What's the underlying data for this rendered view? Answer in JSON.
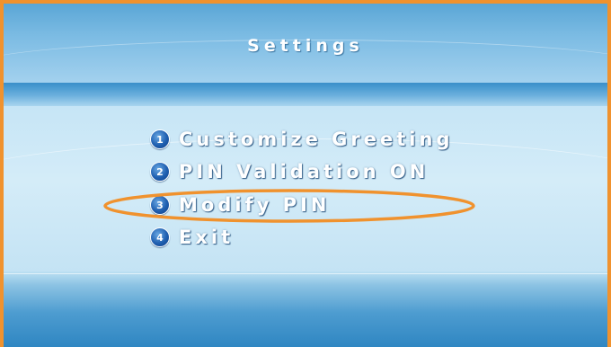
{
  "screen": {
    "title": "Settings"
  },
  "menu": {
    "items": [
      {
        "number": "1",
        "label": "Customize Greeting"
      },
      {
        "number": "2",
        "label": "PIN Validation ON"
      },
      {
        "number": "3",
        "label": "Modify PIN"
      },
      {
        "number": "4",
        "label": "Exit"
      }
    ],
    "highlighted_item": "Modify PIN"
  },
  "colors": {
    "frame_border": "#f0922e",
    "highlight_ellipse": "#f0922e",
    "number_badge": "#1f5fb0",
    "label_text": "#ffffff"
  },
  "icons": [
    "number-badge-icon"
  ]
}
